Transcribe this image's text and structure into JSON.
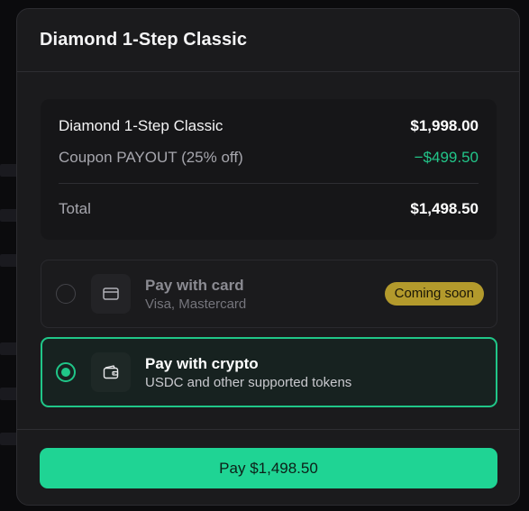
{
  "modal": {
    "title": "Diamond 1-Step Classic"
  },
  "summary": {
    "item_label": "Diamond 1-Step Classic",
    "item_amount": "$1,998.00",
    "coupon_label": "Coupon PAYOUT (25% off)",
    "coupon_amount": "−$499.50",
    "total_label": "Total",
    "total_amount": "$1,498.50"
  },
  "payment_options": [
    {
      "title": "Pay with card",
      "subtitle": "Visa, Mastercard",
      "icon": "credit-card-icon",
      "badge": "Coming soon",
      "selected": false,
      "disabled": true
    },
    {
      "title": "Pay with crypto",
      "subtitle": "USDC and other supported tokens",
      "icon": "wallet-icon",
      "selected": true,
      "disabled": false
    }
  ],
  "footer": {
    "pay_label": "Pay $1,498.50"
  },
  "colors": {
    "accent": "#1fd494",
    "discount": "#22c589",
    "badge": "#b39a2c",
    "modal_bg": "#1b1b1d"
  }
}
